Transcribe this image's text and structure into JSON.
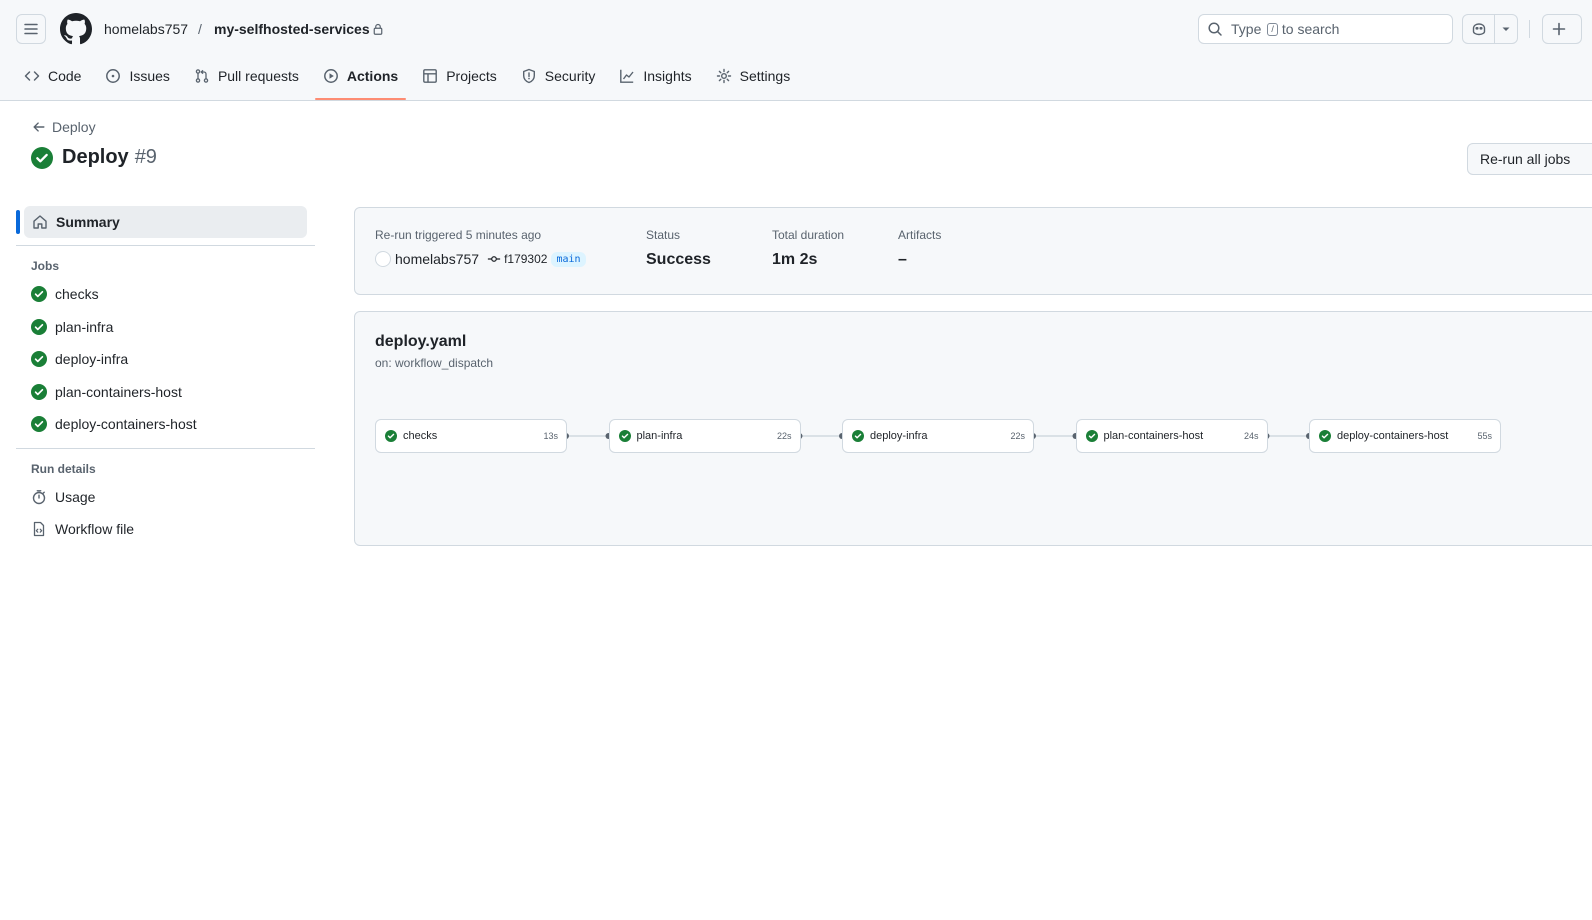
{
  "header": {
    "owner": "homelabs757",
    "separator": "/",
    "repo": "my-selfhosted-services",
    "search_pre": "Type",
    "search_key": "/",
    "search_post": "to search"
  },
  "nav": {
    "items": [
      {
        "label": "Code",
        "icon": "code-icon"
      },
      {
        "label": "Issues",
        "icon": "issue-opened-icon"
      },
      {
        "label": "Pull requests",
        "icon": "git-pull-request-icon"
      },
      {
        "label": "Actions",
        "icon": "play-icon",
        "selected": true
      },
      {
        "label": "Projects",
        "icon": "table-icon"
      },
      {
        "label": "Security",
        "icon": "shield-icon"
      },
      {
        "label": "Insights",
        "icon": "graph-icon"
      },
      {
        "label": "Settings",
        "icon": "gear-icon"
      }
    ]
  },
  "run": {
    "back_label": "Deploy",
    "title": "Deploy",
    "number": "#9",
    "rerun_button": "Re-run all jobs"
  },
  "sidebar": {
    "summary": "Summary",
    "jobs_heading": "Jobs",
    "jobs": [
      "checks",
      "plan-infra",
      "deploy-infra",
      "plan-containers-host",
      "deploy-containers-host"
    ],
    "details_heading": "Run details",
    "usage": "Usage",
    "workflow_file": "Workflow file"
  },
  "summary": {
    "trigger_label": "Re-run triggered 5 minutes ago",
    "actor": "homelabs757",
    "commit": "f179302",
    "branch": "main",
    "status_label": "Status",
    "status": "Success",
    "duration_label": "Total duration",
    "duration": "1m 2s",
    "artifacts_label": "Artifacts",
    "artifacts": "–"
  },
  "workflow": {
    "file": "deploy.yaml",
    "trigger": "on: workflow_dispatch",
    "jobs": [
      {
        "name": "checks",
        "duration": "13s"
      },
      {
        "name": "plan-infra",
        "duration": "22s"
      },
      {
        "name": "deploy-infra",
        "duration": "22s"
      },
      {
        "name": "plan-containers-host",
        "duration": "24s"
      },
      {
        "name": "deploy-containers-host",
        "duration": "55s"
      }
    ]
  },
  "colors": {
    "success": "#1a7f37",
    "accent": "#0969da",
    "tab_underline": "#fd8c73"
  }
}
